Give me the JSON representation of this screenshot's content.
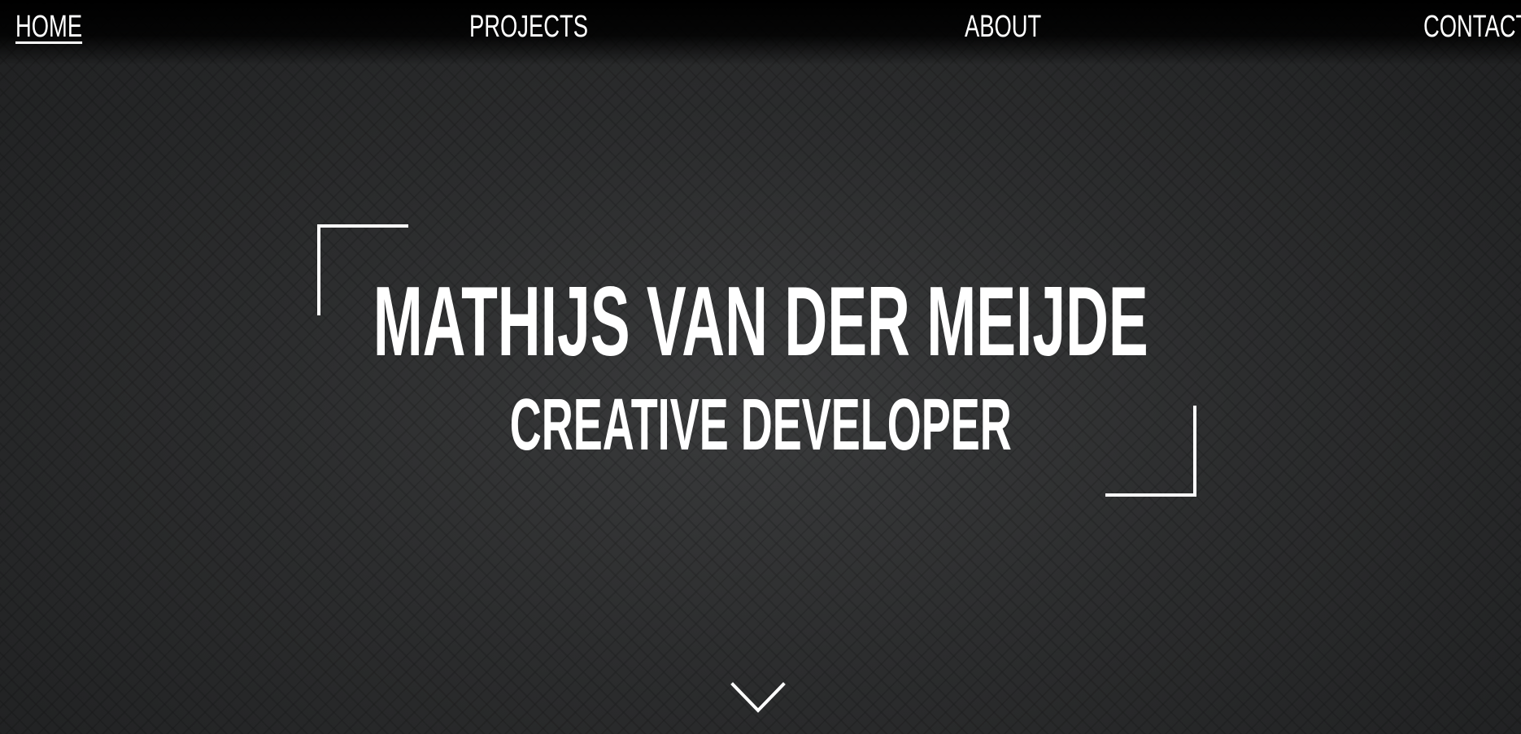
{
  "nav": {
    "items": [
      {
        "label": "HOME",
        "active": true
      },
      {
        "label": "PROJECTS",
        "active": false
      },
      {
        "label": "ABOUT",
        "active": false
      },
      {
        "label": "CONTACT",
        "active": false
      }
    ]
  },
  "hero": {
    "name": "MATHIJS VAN DER MEIJDE",
    "role": "CREATIVE DEVELOPER"
  },
  "icons": {
    "scroll": "chevron-down-icon"
  },
  "colors": {
    "background": "#2a2b2c",
    "text": "#ffffff",
    "nav_bar": "#000000"
  }
}
